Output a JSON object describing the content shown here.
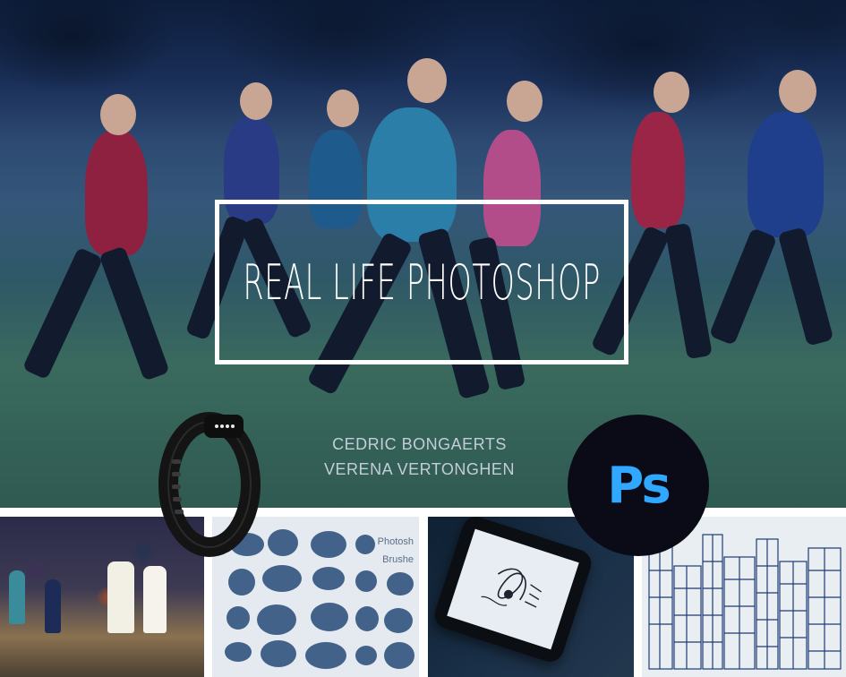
{
  "hero": {
    "title": "REAL LIFE PHOTOSHOP",
    "authors": [
      "CEDRIC BONGAERTS",
      "VERENA VERTONGHEN"
    ]
  },
  "logo": {
    "text": "Ps",
    "color": "#31a8ff",
    "background": "#0a0b16"
  },
  "strip": {
    "brushes_label": "Photosh Brushe",
    "brushes_label_lines": [
      "Photosh",
      "Brushe"
    ]
  },
  "icons": [
    "fitness-tracker-icon",
    "photoshop-logo-icon"
  ],
  "colors": {
    "title": "#ffffff",
    "authors": "#c3cdd9",
    "hero_tint": "#2d4a72"
  }
}
